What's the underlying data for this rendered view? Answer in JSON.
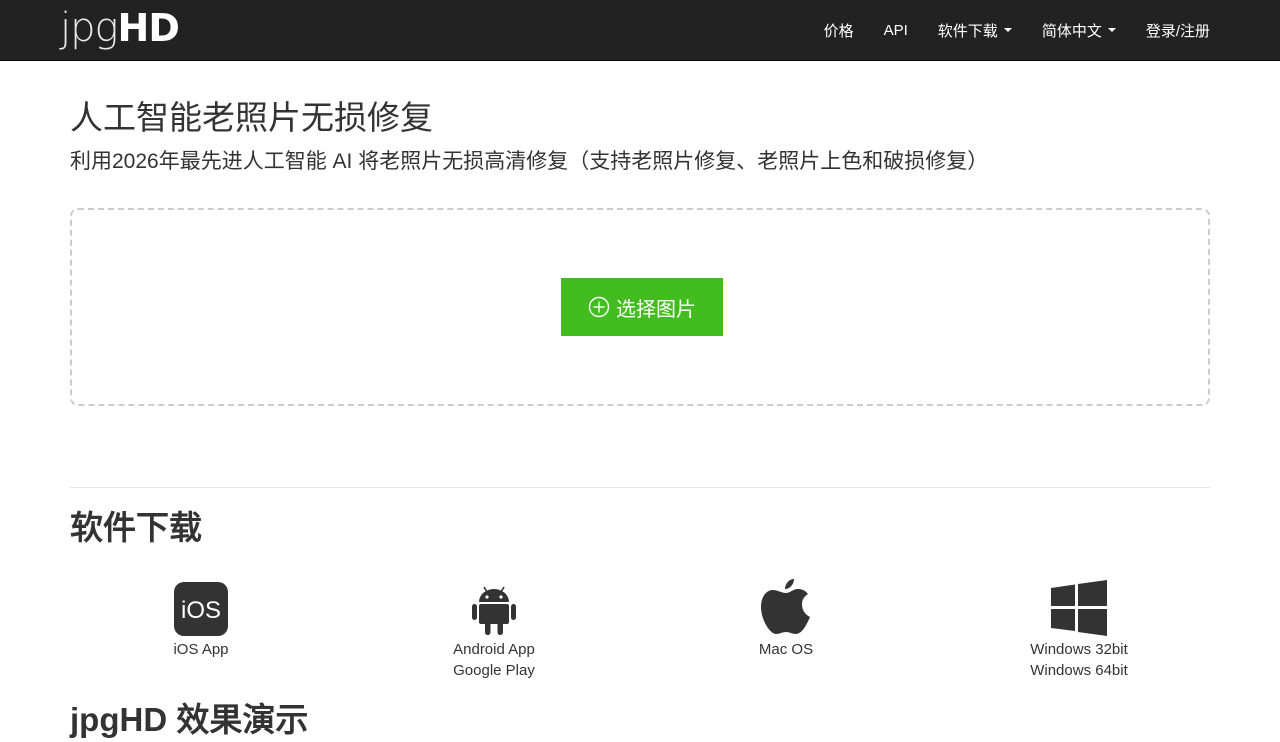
{
  "logo": {
    "light": "jpg",
    "bold": "HD"
  },
  "nav": {
    "pricing": "价格",
    "api": "API",
    "download": "软件下载",
    "language": "简体中文",
    "login": "登录/注册"
  },
  "hero": {
    "title": "人工智能老照片无损修复",
    "subtitle": "利用2026年最先进人工智能 AI 将老照片无损高清修复（支持老照片修复、老照片上色和破损修复）"
  },
  "upload": {
    "button_label": "选择图片"
  },
  "downloads": {
    "title": "软件下载",
    "items": [
      {
        "icon": "ios-icon",
        "icon_text": "iOS",
        "label": "iOS App"
      },
      {
        "icon": "android-icon",
        "label": "Android App",
        "label2": "Google Play"
      },
      {
        "icon": "apple-icon",
        "label": "Mac OS"
      },
      {
        "icon": "windows-icon",
        "label": "Windows 32bit",
        "label2": "Windows 64bit"
      }
    ]
  },
  "demo": {
    "title": "jpgHD 效果演示"
  },
  "colors": {
    "navbar": "#222222",
    "accent_green": "#43bc1f",
    "text": "#333333"
  }
}
